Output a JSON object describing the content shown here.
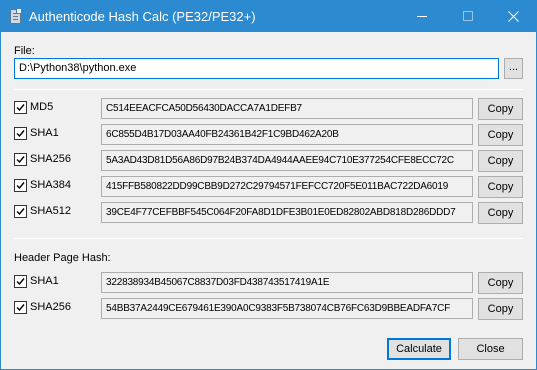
{
  "window": {
    "title": "Authenticode Hash Calc (PE32/PE32+)"
  },
  "file": {
    "label": "File:",
    "path": "D:\\Python38\\python.exe",
    "browse_label": "..."
  },
  "hashes": [
    {
      "name": "MD5",
      "checked": true,
      "value": "C514EEACFCA50D56430DACCA7A1DEFB7",
      "copy_label": "Copy"
    },
    {
      "name": "SHA1",
      "checked": true,
      "value": "6C855D4B17D03AA40FB24361B42F1C9BD462A20B",
      "copy_label": "Copy"
    },
    {
      "name": "SHA256",
      "checked": true,
      "value": "5A3AD43D81D56A86D97B24B374DA4944AAEE94C710E377254CFE8ECC72C",
      "copy_label": "Copy"
    },
    {
      "name": "SHA384",
      "checked": true,
      "value": "415FFB580822DD99CBB9D272C29794571FEFCC720F5E011BAC722DA6019",
      "copy_label": "Copy"
    },
    {
      "name": "SHA512",
      "checked": true,
      "value": "39CE4F77CEFBBF545C064F20FA8D1DFE3B01E0ED82802ABD818D286DDD7",
      "copy_label": "Copy"
    }
  ],
  "header_page_hash": {
    "label": "Header Page Hash:",
    "items": [
      {
        "name": "SHA1",
        "checked": true,
        "value": "322838934B45067C8837D03FD438743517419A1E",
        "copy_label": "Copy"
      },
      {
        "name": "SHA256",
        "checked": true,
        "value": "54BB37A2449CE679461E390A0C9383F5B738074CB76FC63D9BBEADFA7CF",
        "copy_label": "Copy"
      }
    ]
  },
  "actions": {
    "calculate_label": "Calculate",
    "close_label": "Close"
  },
  "colors": {
    "titlebar": "#2b8ad0",
    "dialog_bg": "#f0f0f0",
    "focus_border": "#0078d7"
  }
}
